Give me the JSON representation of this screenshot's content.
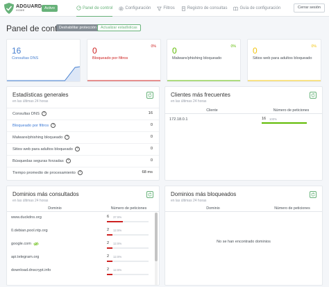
{
  "header": {
    "logo_title": "ADGUARD",
    "logo_subtitle": "HOME",
    "version_badge": "Activo",
    "nav": [
      {
        "label": "Panel de control",
        "icon": "dashboard-icon",
        "active": true
      },
      {
        "label": "Configuración",
        "icon": "gear-icon",
        "active": false
      },
      {
        "label": "Filtros",
        "icon": "filter-icon",
        "active": false
      },
      {
        "label": "Registro de consultas",
        "icon": "log-icon",
        "active": false
      },
      {
        "label": "Guía de configuración",
        "icon": "book-icon",
        "active": false
      }
    ],
    "logout_label": "Cerrar sesión"
  },
  "page": {
    "title": "Panel de control",
    "disable_protection_label": "Deshabilitar protección",
    "refresh_stats_label": "Actualizar estadísticas"
  },
  "stats": [
    {
      "value": "16",
      "label": "Consultas DNS",
      "percent": "",
      "color": "#467fcf"
    },
    {
      "value": "0",
      "label": "Bloqueado por filtros",
      "percent": "0%",
      "color": "#cd201f"
    },
    {
      "value": "0",
      "label": "Malware/phishing bloqueado",
      "percent": "0%",
      "color": "#5eba00"
    },
    {
      "value": "0",
      "label": "Sitios web para adultos bloqueado",
      "percent": "0%",
      "color": "#f1c40f"
    }
  ],
  "general_stats": {
    "title": "Estadísticas generales",
    "subtitle": "en las últimas 24 horas",
    "rows": [
      {
        "label": "Consultas DNS",
        "value": "16",
        "help": true,
        "link": false
      },
      {
        "label": "Bloqueado por filtros",
        "value": "0",
        "help": true,
        "link": true
      },
      {
        "label": "Malware/phishing bloqueado",
        "value": "0",
        "help": true,
        "link": false
      },
      {
        "label": "Sitios web para adultos bloqueado",
        "value": "0",
        "help": true,
        "link": false
      },
      {
        "label": "Búsquedas seguras forzadas",
        "value": "0",
        "help": true,
        "link": false
      },
      {
        "label": "Tiempo promedio de procesamiento",
        "value": "68 ms",
        "help": true,
        "link": false
      }
    ]
  },
  "top_clients": {
    "title": "Clientes más frecuentes",
    "subtitle": "en las últimas 24 horas",
    "col_client": "Cliente",
    "col_requests": "Número de peticiones",
    "rows": [
      {
        "client": "172.18.0.1",
        "count": "16",
        "percent": "100%",
        "fraction": 1.0
      }
    ]
  },
  "top_queried": {
    "title": "Dominios más consultados",
    "subtitle": "en las últimas 24 horas",
    "col_domain": "Dominio",
    "col_requests": "Número de peticiones",
    "rows": [
      {
        "domain": "www.duckdns.org",
        "count": "6",
        "percent": "37.5%",
        "fraction": 0.375,
        "icon": ""
      },
      {
        "domain": "0.debian.pool.ntp.org",
        "count": "2",
        "percent": "12.5%",
        "fraction": 0.125,
        "icon": ""
      },
      {
        "domain": "google.com",
        "count": "2",
        "percent": "12.5%",
        "fraction": 0.125,
        "icon": "eye-slash-icon"
      },
      {
        "domain": "api.telegram.org",
        "count": "2",
        "percent": "12.5%",
        "fraction": 0.125,
        "icon": ""
      },
      {
        "domain": "download.dnscrypt.info",
        "count": "2",
        "percent": "12.5%",
        "fraction": 0.125,
        "icon": ""
      }
    ]
  },
  "top_blocked": {
    "title": "Dominios más bloqueados",
    "subtitle": "en las últimas 24 horas",
    "col_domain": "Dominio",
    "col_requests": "Número de peticiones",
    "empty_message": "No se han encontrado dominios"
  },
  "colors": {
    "accent": "#67b279",
    "bar_red": "#cd201f",
    "bar_green": "#5eba00",
    "link": "#3d7ad6"
  }
}
